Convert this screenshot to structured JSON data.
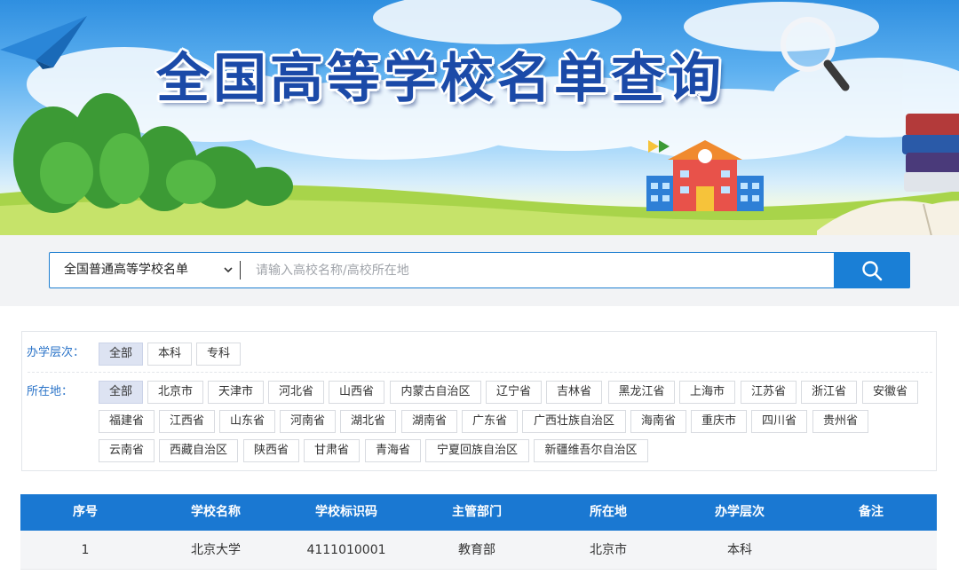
{
  "banner": {
    "title": "全国高等学校名单查询"
  },
  "search": {
    "category_selected": "全国普通高等学校名单",
    "placeholder": "请输入高校名称/高校所在地",
    "button_icon": "search-icon"
  },
  "filters": {
    "level_label": "办学层次：",
    "level_options": [
      "全部",
      "本科",
      "专科"
    ],
    "level_selected": "全部",
    "location_label": "所在地：",
    "location_selected": "全部",
    "location_options": [
      "全部",
      "北京市",
      "天津市",
      "河北省",
      "山西省",
      "内蒙古自治区",
      "辽宁省",
      "吉林省",
      "黑龙江省",
      "上海市",
      "江苏省",
      "浙江省",
      "安徽省",
      "福建省",
      "江西省",
      "山东省",
      "河南省",
      "湖北省",
      "湖南省",
      "广东省",
      "广西壮族自治区",
      "海南省",
      "重庆市",
      "四川省",
      "贵州省",
      "云南省",
      "西藏自治区",
      "陕西省",
      "甘肃省",
      "青海省",
      "宁夏回族自治区",
      "新疆维吾尔自治区"
    ]
  },
  "table": {
    "headers": [
      "序号",
      "学校名称",
      "学校标识码",
      "主管部门",
      "所在地",
      "办学层次",
      "备注"
    ],
    "rows": [
      [
        "1",
        "北京大学",
        "4111010001",
        "教育部",
        "北京市",
        "本科",
        ""
      ]
    ]
  },
  "colors": {
    "accent": "#1a78d2",
    "title": "#1b4aa8",
    "filter_label": "#2a73c8",
    "chip_active": "#dde3f2"
  }
}
